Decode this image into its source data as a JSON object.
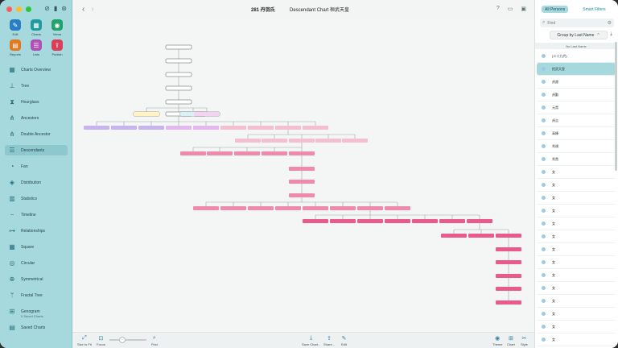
{
  "window": {
    "title": "281 丹羽氏",
    "chart_title": "Descendant Chart 桓武天皇"
  },
  "sidebar": {
    "actions": [
      {
        "label": "Edit",
        "icon": "pencil-icon",
        "color": "#2a7fc4"
      },
      {
        "label": "Charts",
        "icon": "charts-icon",
        "color": "#1f9a9e"
      },
      {
        "label": "Views",
        "icon": "eye-icon",
        "color": "#24a06a"
      },
      {
        "label": "Reports",
        "icon": "reports-icon",
        "color": "#e0791f"
      },
      {
        "label": "Lists",
        "icon": "lists-icon",
        "color": "#b051b8"
      },
      {
        "label": "Publish",
        "icon": "publish-icon",
        "color": "#d83f5a"
      }
    ],
    "items": [
      {
        "label": "Charts Overview",
        "icon": "grid-icon"
      },
      {
        "label": "Tree",
        "icon": "tree-icon"
      },
      {
        "label": "Hourglass",
        "icon": "hourglass-icon"
      },
      {
        "label": "Ancestors",
        "icon": "ancestors-icon"
      },
      {
        "label": "Double Ancestor",
        "icon": "double-ancestor-icon"
      },
      {
        "label": "Descendants",
        "icon": "descendants-icon",
        "selected": true
      },
      {
        "label": "Fan",
        "icon": "fan-icon"
      },
      {
        "label": "Distribution",
        "icon": "distribution-icon"
      },
      {
        "label": "Statistics",
        "icon": "statistics-icon"
      },
      {
        "label": "Timeline",
        "icon": "timeline-icon"
      },
      {
        "label": "Relationships",
        "icon": "relationships-icon"
      },
      {
        "label": "Square",
        "icon": "square-icon"
      },
      {
        "label": "Circular",
        "icon": "circular-icon"
      },
      {
        "label": "Symmetrical",
        "icon": "symmetrical-icon"
      },
      {
        "label": "Fractal Tree",
        "icon": "fractal-tree-icon"
      },
      {
        "label": "Genogram",
        "icon": "genogram-icon"
      },
      {
        "label": "Saved Charts",
        "icon": "saved-charts-icon"
      }
    ],
    "saved_charts_sub": "0 Saved Charts"
  },
  "bottombar": {
    "size_to_fit": "Size to Fit",
    "focus": "Focus",
    "find": "Find",
    "save_chart": "Save Chart...",
    "share": "Share...",
    "edit": "Edit",
    "theme": "Theme",
    "chart": "Chart",
    "style": "Style"
  },
  "panel": {
    "tabs": [
      "All Persons",
      "Smart Filters"
    ],
    "search_placeholder": "Find",
    "group_by": "Group by Last Name",
    "section": "No Last Name",
    "persons": [
      "(二十九代)",
      "桓武天皇",
      "貞慮",
      "貞勤",
      "元貴",
      "貞吉",
      "高棟",
      "秀規",
      "秀貴",
      "女",
      "女",
      "女",
      "女",
      "女",
      "女",
      "女",
      "女",
      "女",
      "女",
      "女",
      "女",
      "女",
      "女"
    ],
    "selected_index": 1
  },
  "colors": {
    "accent": "#a6d9dd",
    "node_white": "#ffffff",
    "node_purple": "#c7b3ee",
    "node_lavender": "#e3b8ef",
    "node_pink_light": "#f4bfd0",
    "node_pink": "#ef8aab",
    "node_pink_dark": "#e85b8a"
  }
}
